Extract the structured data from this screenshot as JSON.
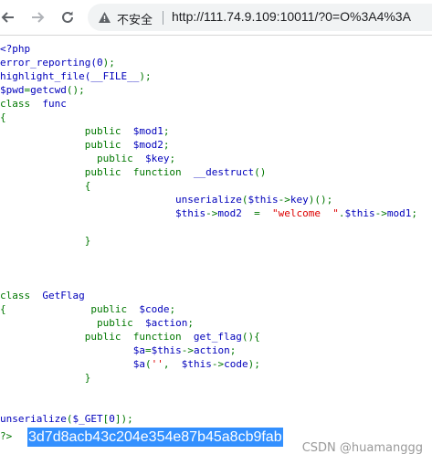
{
  "browser": {
    "back_icon": "arrow-left-icon",
    "forward_icon": "arrow-right-icon",
    "reload_icon": "reload-icon",
    "security_icon": "warning-triangle-icon",
    "security_label": "不安全",
    "url": "http://111.74.9.109:10011/?0=O%3A4%3A"
  },
  "code_lines": [
    [
      {
        "t": "<?php",
        "c": "blue"
      }
    ],
    [
      {
        "t": "error_reporting(",
        "c": "blue"
      },
      {
        "t": "0",
        "c": "blue"
      },
      {
        "t": ");",
        "c": "green"
      }
    ],
    [
      {
        "t": "highlight_file(",
        "c": "blue"
      },
      {
        "t": "__FILE__",
        "c": "blue"
      },
      {
        "t": ");",
        "c": "green"
      }
    ],
    [
      {
        "t": "$pwd",
        "c": "blue"
      },
      {
        "t": "=",
        "c": "green"
      },
      {
        "t": "getcwd",
        "c": "blue"
      },
      {
        "t": "();",
        "c": "green"
      }
    ],
    [
      {
        "t": "class  ",
        "c": "green"
      },
      {
        "t": "func",
        "c": "blue"
      }
    ],
    [
      {
        "t": "{",
        "c": "green"
      }
    ],
    [
      {
        "t": "              public  ",
        "c": "green"
      },
      {
        "t": "$mod1",
        "c": "blue"
      },
      {
        "t": ";",
        "c": "green"
      }
    ],
    [
      {
        "t": "              public  ",
        "c": "green"
      },
      {
        "t": "$mod2",
        "c": "blue"
      },
      {
        "t": ";",
        "c": "green"
      }
    ],
    [
      {
        "t": "                public  ",
        "c": "green"
      },
      {
        "t": "$key",
        "c": "blue"
      },
      {
        "t": ";",
        "c": "green"
      }
    ],
    [
      {
        "t": "              public  function  ",
        "c": "green"
      },
      {
        "t": "__destruct",
        "c": "blue"
      },
      {
        "t": "()",
        "c": "green"
      }
    ],
    [
      {
        "t": "              {",
        "c": "green"
      }
    ],
    [
      {
        "t": "                             unserialize",
        "c": "blue"
      },
      {
        "t": "(",
        "c": "green"
      },
      {
        "t": "$this",
        "c": "blue"
      },
      {
        "t": "->",
        "c": "green"
      },
      {
        "t": "key",
        "c": "blue"
      },
      {
        "t": ")();",
        "c": "green"
      }
    ],
    [
      {
        "t": "                             $this",
        "c": "blue"
      },
      {
        "t": "->",
        "c": "green"
      },
      {
        "t": "mod2  ",
        "c": "blue"
      },
      {
        "t": "=  ",
        "c": "green"
      },
      {
        "t": "\"welcome  \"",
        "c": "red"
      },
      {
        "t": ".",
        "c": "green"
      },
      {
        "t": "$this",
        "c": "blue"
      },
      {
        "t": "->",
        "c": "green"
      },
      {
        "t": "mod1",
        "c": "blue"
      },
      {
        "t": ";",
        "c": "green"
      }
    ],
    [],
    [
      {
        "t": "              }",
        "c": "green"
      }
    ],
    [],
    [],
    [],
    [
      {
        "t": "class  ",
        "c": "green"
      },
      {
        "t": "GetFlag",
        "c": "blue"
      }
    ],
    [
      {
        "t": "{              public  ",
        "c": "green"
      },
      {
        "t": "$code",
        "c": "blue"
      },
      {
        "t": ";",
        "c": "green"
      }
    ],
    [
      {
        "t": "                public  ",
        "c": "green"
      },
      {
        "t": "$action",
        "c": "blue"
      },
      {
        "t": ";",
        "c": "green"
      }
    ],
    [
      {
        "t": "              public  function  ",
        "c": "green"
      },
      {
        "t": "get_flag",
        "c": "blue"
      },
      {
        "t": "(){",
        "c": "green"
      }
    ],
    [
      {
        "t": "                      $a",
        "c": "blue"
      },
      {
        "t": "=",
        "c": "green"
      },
      {
        "t": "$this",
        "c": "blue"
      },
      {
        "t": "->",
        "c": "green"
      },
      {
        "t": "action",
        "c": "blue"
      },
      {
        "t": ";",
        "c": "green"
      }
    ],
    [
      {
        "t": "                      $a",
        "c": "blue"
      },
      {
        "t": "(",
        "c": "green"
      },
      {
        "t": "''",
        "c": "red"
      },
      {
        "t": ",  ",
        "c": "green"
      },
      {
        "t": "$this",
        "c": "blue"
      },
      {
        "t": "->",
        "c": "green"
      },
      {
        "t": "code",
        "c": "blue"
      },
      {
        "t": ");",
        "c": "green"
      }
    ],
    [
      {
        "t": "              }",
        "c": "green"
      }
    ],
    [],
    [],
    [
      {
        "t": "unserialize",
        "c": "blue"
      },
      {
        "t": "(",
        "c": "green"
      },
      {
        "t": "$_GET",
        "c": "blue"
      },
      {
        "t": "[",
        "c": "green"
      },
      {
        "t": "0",
        "c": "blue"
      },
      {
        "t": "]);",
        "c": "green"
      }
    ]
  ],
  "output": {
    "prefix": "?>",
    "flag": "3d7d8acb43c204e354e87b45a8cb9fab"
  },
  "watermark": "CSDN @huamanggg",
  "colors": {
    "php_keyword": "#007700",
    "php_default": "#0000bb",
    "php_string": "#dd0000",
    "selection": "#3390ff"
  }
}
